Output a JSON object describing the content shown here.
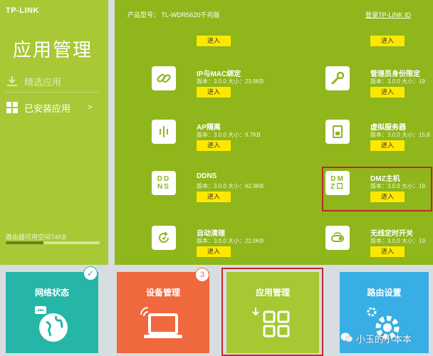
{
  "brand": "TP-LINK",
  "sidebar": {
    "title": "应用管理",
    "items": [
      {
        "label": "精选应用"
      },
      {
        "label": "已安装应用",
        "chevron": ">"
      }
    ],
    "storage": {
      "text": "路由器可用空间74KB",
      "fraction": 0.4
    }
  },
  "topbar": {
    "model": "产品型号：  TL-WDR5620千兆版",
    "login": "登录TP-LINK ID"
  },
  "apps": {
    "left": [
      {
        "name": "",
        "meta": "",
        "button": "进入",
        "icon": "app-icon"
      },
      {
        "name": "IP与MAC绑定",
        "meta": "版本：3.0.0 大小：23.9KB",
        "button": "进入",
        "icon": "link-icon"
      },
      {
        "name": "AP隔离",
        "meta": "版本：3.0.0 大小：9.7KB",
        "button": "进入",
        "icon": "ap-isolation-icon"
      },
      {
        "name": "DDNS",
        "meta": "版本：3.0.0 大小：62.9KB",
        "button": "进入",
        "icon": "ddns-icon"
      },
      {
        "name": "自动清理",
        "meta": "版本：3.0.0 大小：22.0KB",
        "button": "进入",
        "icon": "auto-clean-icon"
      }
    ],
    "right": [
      {
        "name": "",
        "meta": "",
        "button": "进入",
        "icon": "app-icon"
      },
      {
        "name": "管理员身份限定",
        "meta": "版本：3.0.0 大小：19",
        "button": "进入",
        "icon": "wrench-icon"
      },
      {
        "name": "虚拟服务器",
        "meta": "版本：3.0.0 大小：15.8",
        "button": "进入",
        "icon": "server-icon"
      },
      {
        "name": "DMZ主机",
        "meta": "版本：3.0.0 大小：19.",
        "button": "进入",
        "icon": "dmz-icon"
      },
      {
        "name": "无线定时开关",
        "meta": "版本：3.0.0 大小：19.",
        "button": "进入",
        "icon": "wifi-timer-icon"
      }
    ]
  },
  "icon_text": {
    "ddns": [
      "DD",
      "NS"
    ],
    "dmz": [
      "DM",
      "Z口"
    ]
  },
  "nav": [
    {
      "label": "网络状态",
      "color": "#25b6a8",
      "badge": "✓"
    },
    {
      "label": "设备管理",
      "color": "#f0683e",
      "badge": "3"
    },
    {
      "label": "应用管理",
      "color": "#a6c833",
      "badge": ""
    },
    {
      "label": "路由设置",
      "color": "#39aee5",
      "badge": ""
    }
  ],
  "watermark": "小玉的小本本",
  "colors": {
    "sidebar": "#a9c836",
    "main": "#8fb61b",
    "button": "#ffe800",
    "highlight": "#c22828"
  }
}
